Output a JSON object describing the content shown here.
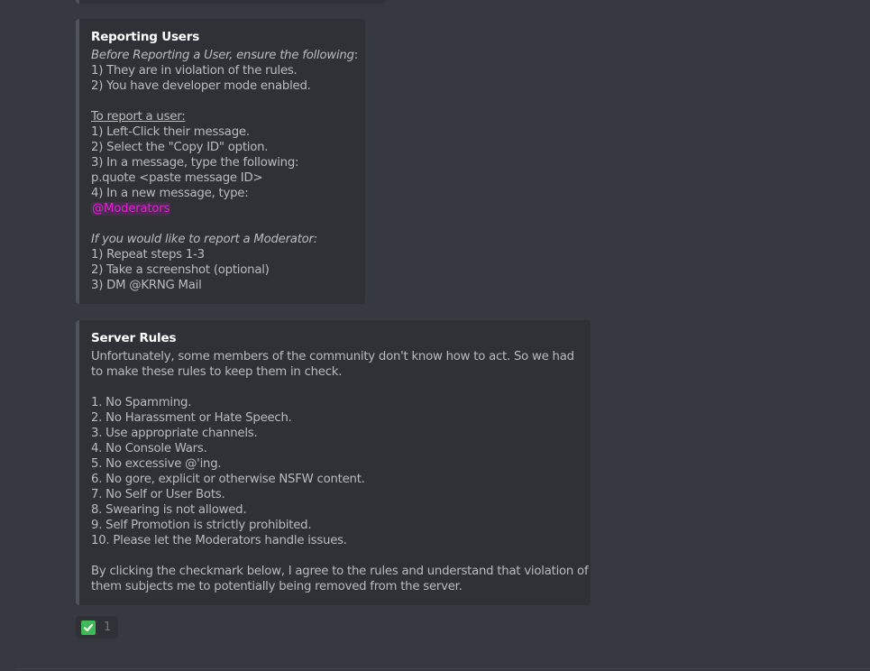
{
  "embeds": {
    "reporting": {
      "title": "Reporting Users",
      "lines": {
        "intro": "Before Reporting a User, ensure the following",
        "intro_colon": ":",
        "req1": "1) They are in violation of the rules.",
        "req2": "2) You have developer mode enabled.",
        "how_heading": "To report a user:",
        "step1": "1) Left-Click their message.",
        "step2": "2) Select the \"Copy ID\" option.",
        "step3": "3) In a message, type the following:",
        "command": "p.quote <paste message ID>",
        "step4": "4) In a new message, type:",
        "mention": "@Moderators",
        "mod_heading": "If you would like to report a Moderator:",
        "mod1": "1) Repeat steps 1-3",
        "mod2": "2) Take a screenshot (optional)",
        "mod3": "3) DM @KRNG Mail"
      }
    },
    "rules": {
      "title": "Server Rules",
      "intro1": "Unfortunately, some members of the community don't know how to act. So we had",
      "intro2": "to make these rules to keep them in check.",
      "items": [
        "1. No Spamming.",
        "2. No Harassment or Hate Speech.",
        "3. Use appropriate channels.",
        "4. No Console Wars.",
        "5. No excessive @'ing.",
        "6. No gore, explicit or otherwise NSFW content.",
        "7. No Self or User Bots.",
        "8. Swearing is not allowed.",
        "9. Self Promotion is strictly prohibited.",
        "10. Please let the Moderators handle issues."
      ],
      "outro1": "By clicking the checkmark below, I agree to the rules and understand that violation of",
      "outro2": "them subjects me to potentially being removed from the server."
    }
  },
  "reaction": {
    "emoji_icon": "white-check-mark-icon",
    "count": "1"
  },
  "colors": {
    "background": "#36393f",
    "embed_bg": "#2f3136",
    "embed_border": "#4f545c",
    "mention": "#e91edb",
    "check_green": "#3fb955"
  }
}
